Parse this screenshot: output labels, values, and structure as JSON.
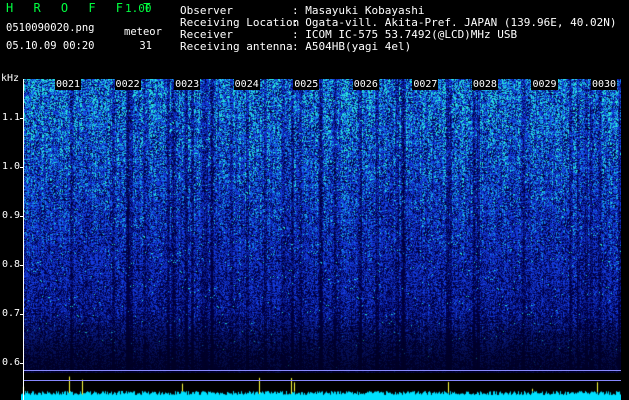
{
  "header": {
    "app_logo": "H R O F F T",
    "version": "1.00",
    "filename": "0510090020.png",
    "datetime": "05.10.09 00:20",
    "meteor_label": "meteor",
    "meteor_count": "31"
  },
  "info": {
    "observer_label": "Observer",
    "observer_value": ": Masayuki Kobayashi",
    "location_label": "Receiving Location",
    "location_value": ": Ogata-vill. Akita-Pref. JAPAN (139.96E, 40.02N)",
    "receiver_label": "Receiver",
    "receiver_value": ": ICOM IC-575 53.7492(@LCD)MHz USB",
    "antenna_label": "Receiving antenna",
    "antenna_value": ": A504HB(yagi 4el)"
  },
  "y_axis": {
    "unit": "kHz",
    "ticks": [
      "1.1",
      "1.0",
      "0.9",
      "0.8",
      "0.7",
      "0.6"
    ],
    "tick_values": [
      1.1,
      1.0,
      0.9,
      0.8,
      0.7,
      0.6
    ],
    "range": [
      0.58,
      1.18
    ]
  },
  "x_axis": {
    "ticks": [
      "0021",
      "0022",
      "0023",
      "0024",
      "0025",
      "0026",
      "0027",
      "0028",
      "0029",
      "0030"
    ]
  },
  "colors": {
    "background": "#000000",
    "logo": "#00ff40",
    "text": "#ffffff",
    "spectrum_low": "#000040",
    "spectrum_mid": "#1030e0",
    "spectrum_high": "#20e0e0",
    "spectrum_peak": "#ffff40",
    "histogram": "#00e0ff"
  }
}
